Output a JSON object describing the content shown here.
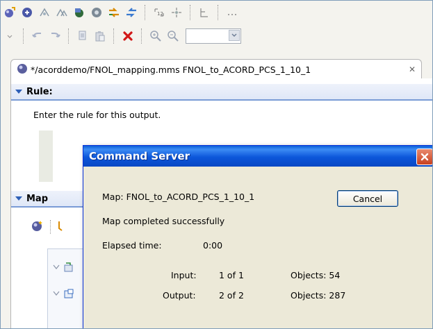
{
  "editor": {
    "tab_title": "*/acorddemo/FNOL_mapping.mms FNOL_to_ACORD_PCS_1_10_1",
    "tab_close_glyph": "✕",
    "rule_section_label": "Rule:",
    "rule_hint": "Enter the rule for this output.",
    "map_section_label": "Map"
  },
  "dialog": {
    "title": "Command Server",
    "map_line": "Map: FNOL_to_ACORD_PCS_1_10_1",
    "status": "Map completed successfully",
    "elapsed_label": "Elapsed time:",
    "elapsed_value": "0:00",
    "input_label": "Input:",
    "input_value": "1 of 1",
    "input_objects": "Objects: 54",
    "output_label": "Output:",
    "output_value": "2 of 2",
    "output_objects": "Objects: 287",
    "cancel_label": "Cancel"
  },
  "icons": {
    "toolbar1": [
      "run-map-icon",
      "run-all-icon",
      "build-icon",
      "build-all-icon",
      "deploy-icon",
      "settings-icon",
      "forward-icon",
      "backward-icon",
      "expand-icon",
      "collapse-icon",
      "tree-icon"
    ],
    "toolbar2": [
      "undo-icon",
      "redo-icon",
      "copy-icon",
      "paste-icon",
      "delete-icon",
      "zoom-in-icon",
      "zoom-out-icon"
    ]
  },
  "colors": {
    "titlebar": "#0c56da",
    "dialog_bg": "#ece9d8",
    "close_button": "#c8401f",
    "section_underline": "#7a9bd6"
  }
}
